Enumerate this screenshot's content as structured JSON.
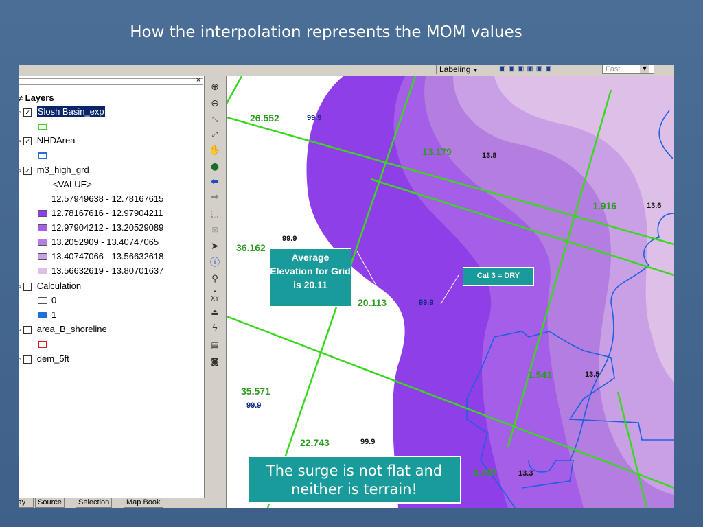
{
  "slide": {
    "title": "How the interpolation represents the MOM values"
  },
  "toolbar": {
    "labeling_label": "Labeling",
    "labeling_arrow": "▼",
    "fast_placeholder": "Fast"
  },
  "toc": {
    "close": "×",
    "root_label": "Layers",
    "layers": [
      {
        "name": "Slosh Basin_exp",
        "checked": "✓",
        "swatch": "#39d81f"
      },
      {
        "name": "NHDArea",
        "checked": "✓",
        "swatch": "#2b6fd6"
      },
      {
        "name": "m3_high_grd",
        "checked": "✓"
      },
      {
        "name": "Calculation",
        "checked": ""
      },
      {
        "name": "area_B_shoreline",
        "checked": "",
        "swatch": "#d42020"
      },
      {
        "name": "dem_5ft",
        "checked": ""
      }
    ],
    "grid_value_header": "<VALUE>",
    "grid_classes": [
      {
        "label": "12.57949638 - 12.78167615",
        "color": "#ffffff"
      },
      {
        "label": "12.78167616 - 12.97904211",
        "color": "#8f3fe8"
      },
      {
        "label": "12.97904212 - 13.20529089",
        "color": "#a55ee8"
      },
      {
        "label": "13.2052909 - 13.40747065",
        "color": "#b47ee0"
      },
      {
        "label": "13.40747066 - 13.56632618",
        "color": "#c9a0e6"
      },
      {
        "label": "13.56632619 - 13.80701637",
        "color": "#ddbfe8"
      }
    ],
    "calc_classes": [
      {
        "label": "0",
        "color": "#ffffff"
      },
      {
        "label": "1",
        "color": "#1f6fd6"
      }
    ],
    "tabs": [
      "Display",
      "Source",
      "Selection",
      "Map Book"
    ]
  },
  "map": {
    "grid_labels": [
      "26.552",
      "13.179",
      "1.916",
      "36.162",
      "20.113",
      "1.541",
      "35.571",
      "22.743",
      "0.287"
    ],
    "mom_labels": [
      "99.9",
      "13.8",
      "13.6",
      "99.9",
      "99.9",
      "13.5",
      "99.9",
      "99.9",
      "13.3"
    ],
    "colors": {
      "grid_line": "#39d81f",
      "nhd_line": "#1f5fe0"
    }
  },
  "callouts": {
    "average": "Average Elevation for Grid is 20.11",
    "cat3": "Cat 3 = DRY",
    "surge": "The surge is not flat and neither is terrain!"
  }
}
